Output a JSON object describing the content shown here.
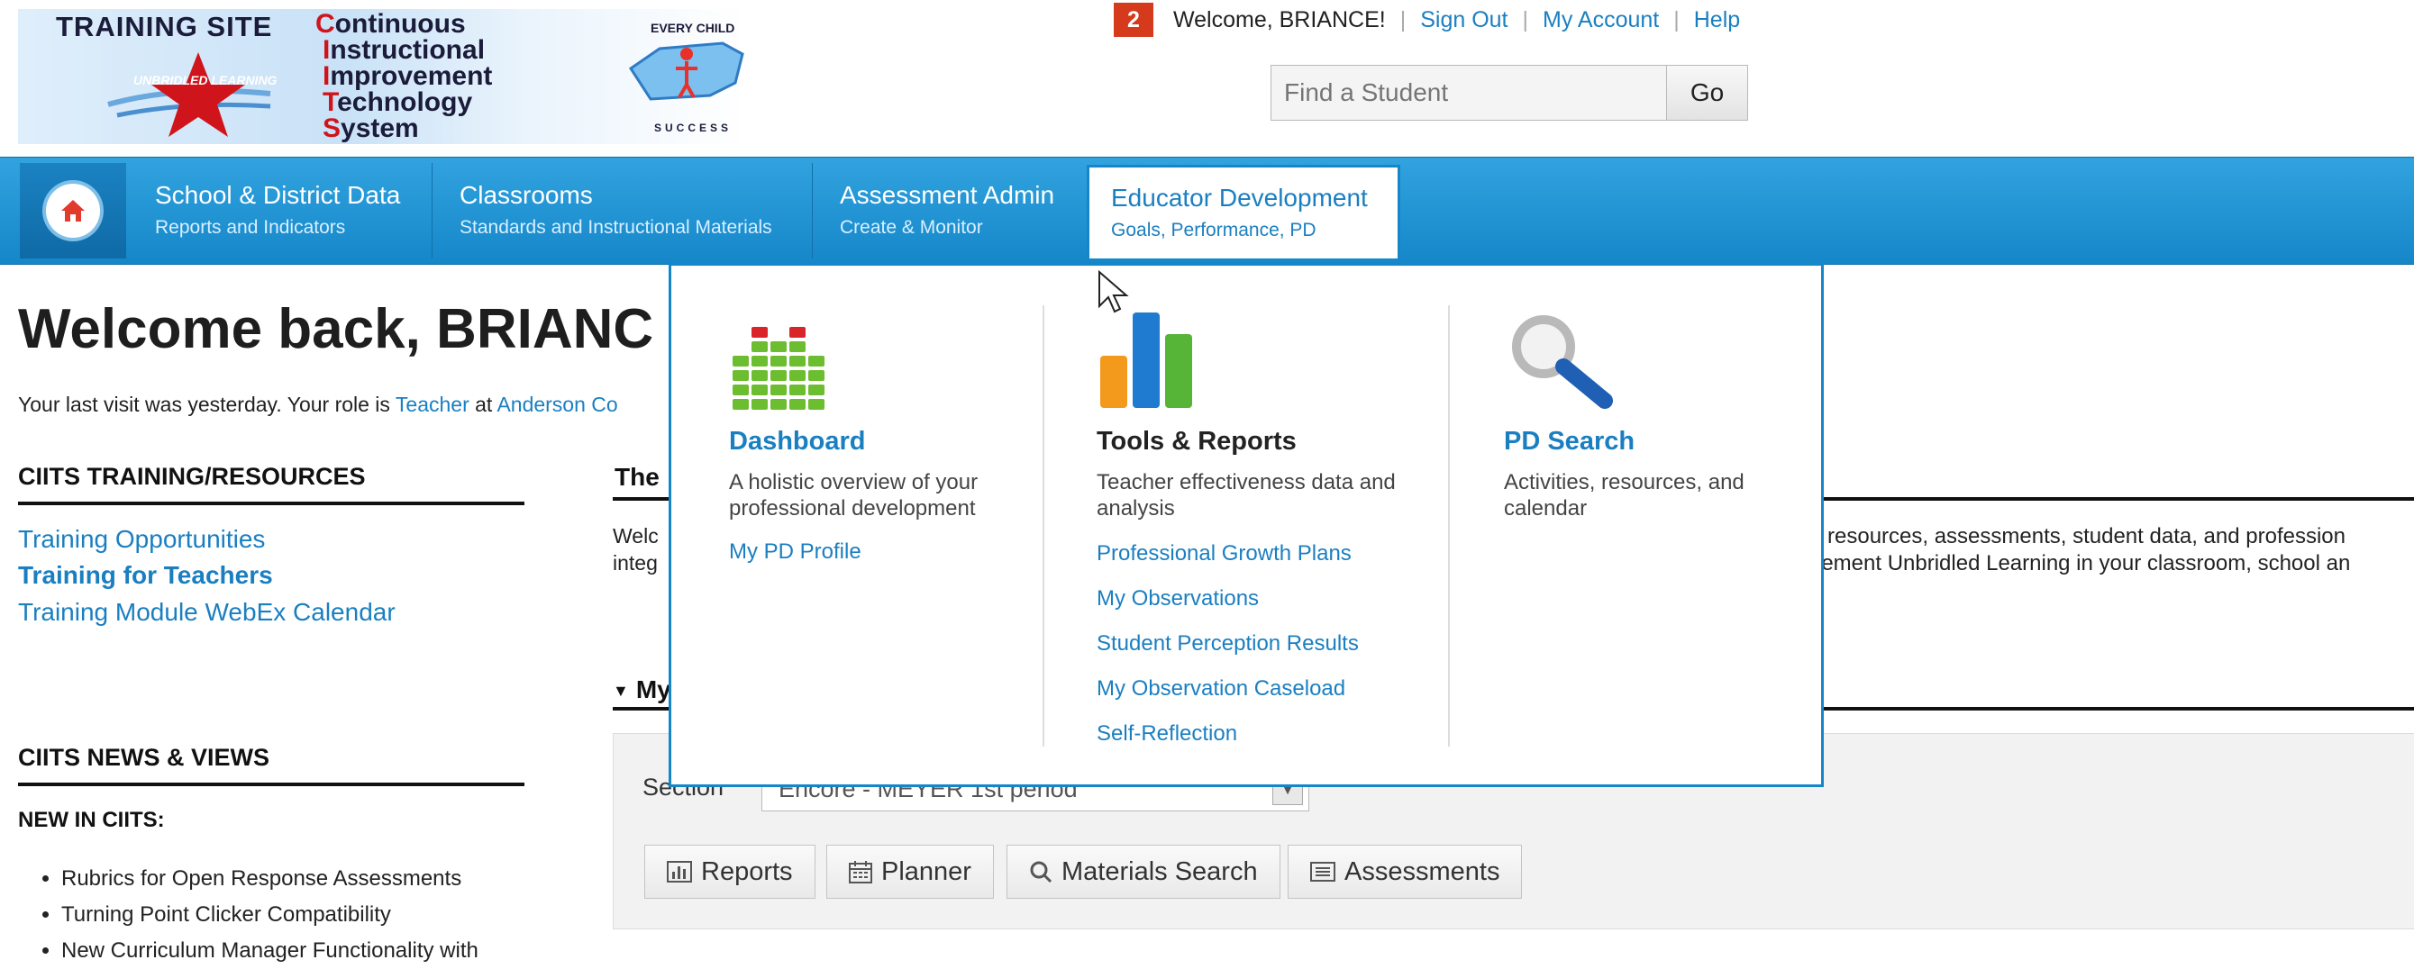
{
  "header": {
    "logo": {
      "training_site": "TRAINING SITE",
      "words": [
        {
          "cap": "C",
          "rest": "ontinuous"
        },
        {
          "cap": "I",
          "rest": "nstructional"
        },
        {
          "cap": "I",
          "rest": "mprovement"
        },
        {
          "cap": "T",
          "rest": "echnology"
        },
        {
          "cap": "S",
          "rest": "ystem"
        }
      ],
      "star_text": "UNBRIDLED LEARNING",
      "child_text": "EVERY CHILD",
      "child_sub": "SUCCESS"
    },
    "notification_count": "2",
    "welcome": "Welcome, BRIANCE!",
    "sign_out": "Sign Out",
    "my_account": "My Account",
    "help": "Help",
    "search": {
      "placeholder": "Find a Student",
      "go": "Go"
    }
  },
  "nav": {
    "items": [
      {
        "title": "School & District Data",
        "subtitle": "Reports and Indicators"
      },
      {
        "title": "Classrooms",
        "subtitle": "Standards and Instructional Materials"
      },
      {
        "title": "Assessment Admin",
        "subtitle": "Create & Monitor"
      },
      {
        "title": "Educator Development",
        "subtitle": "Goals, Performance, PD"
      }
    ]
  },
  "dropdown": {
    "dashboard": {
      "title": "Dashboard",
      "desc": "A holistic overview of your professional development",
      "links": [
        "My PD Profile"
      ]
    },
    "tools": {
      "title": "Tools & Reports",
      "desc": "Teacher effectiveness data and analysis",
      "links": [
        "Professional Growth Plans",
        "My Observations",
        "Student Perception Results",
        "My Observation Caseload",
        "Self-Reflection"
      ]
    },
    "pd_search": {
      "title": "PD Search",
      "desc": "Activities, resources, and calendar"
    }
  },
  "page": {
    "welcome_heading": "Welcome back, BRIANC",
    "last_visit_prefix": "Your last visit was yesterday. Your role is ",
    "role": "Teacher",
    "at": " at ",
    "school_fragment": "Anderson Co",
    "resources_heading": "CIITS TRAINING/RESOURCES",
    "resources_links": [
      "Training Opportunities",
      "Training for Teachers",
      "Training Module WebEx Calendar"
    ],
    "news_heading": "CIITS NEWS & VIEWS",
    "new_in": "NEW IN CIITS:",
    "news_items": [
      "Rubrics for Open Response Assessments",
      "Turning Point Clicker Compatibility",
      "New Curriculum Manager Functionality with"
    ],
    "main_heading_fragment": "The",
    "intro_left": [
      "Welc",
      "integ"
    ],
    "intro_right": [
      "l resources, assessments, student data, and profession",
      "lement Unbridled Learning in your classroom, school an"
    ],
    "collapse_label": "My",
    "section_label": "Section",
    "section_value": "Encore - MEYER 1st period",
    "buttons": {
      "reports": "Reports",
      "planner": "Planner",
      "materials": "Materials Search",
      "assessments": "Assessments"
    }
  },
  "colors": {
    "nav_blue": "#1587c9",
    "link_blue": "#1a7fc1",
    "badge_red": "#d53a1c"
  }
}
